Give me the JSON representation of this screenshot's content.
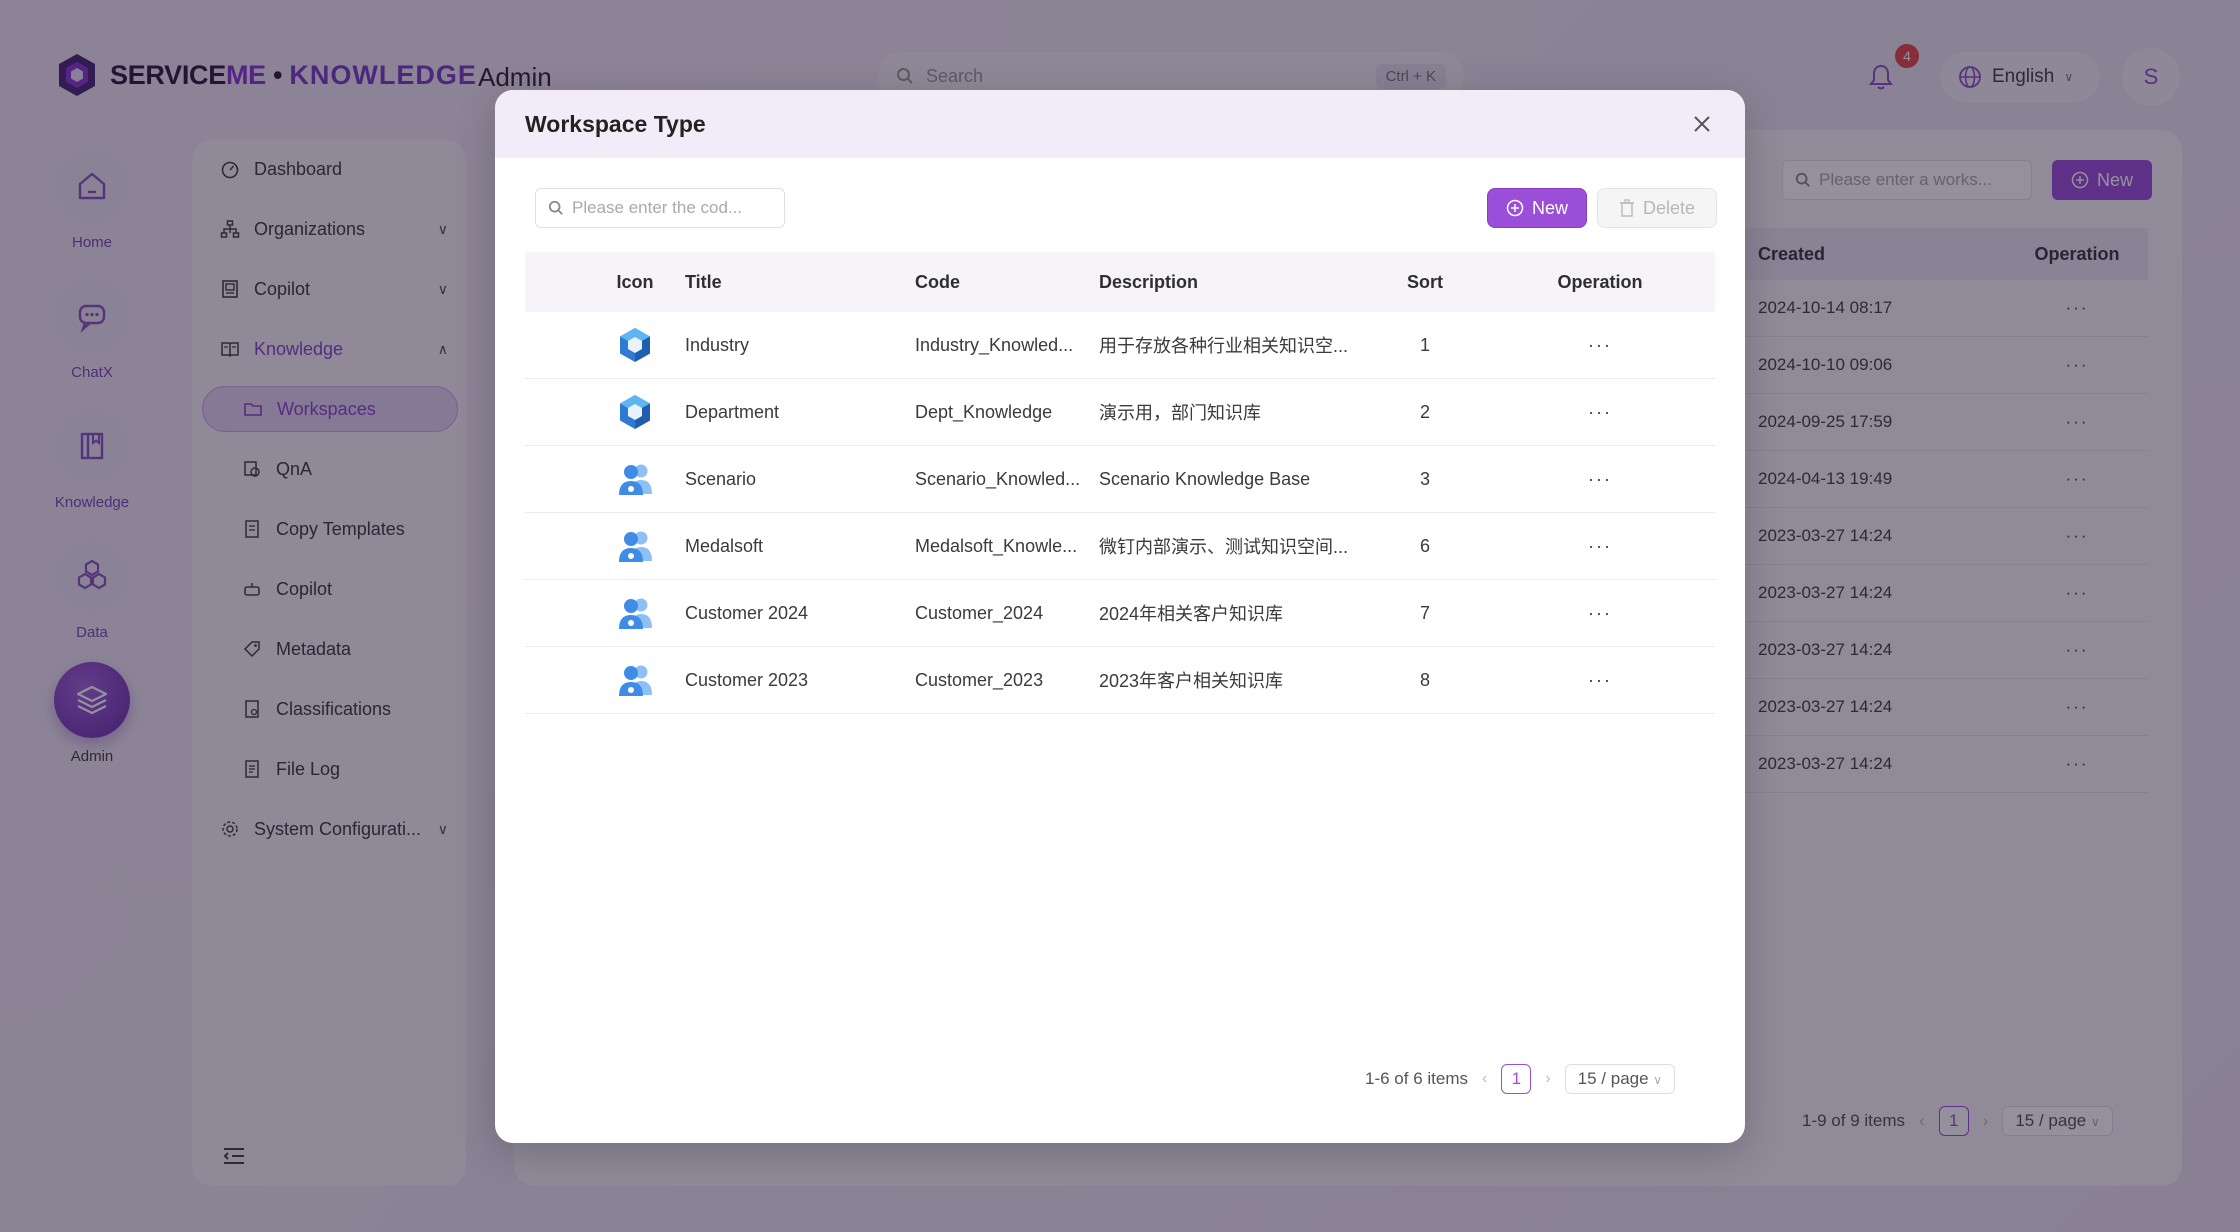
{
  "app": {
    "logo_service": "SERVICE",
    "logo_me": "ME",
    "logo_dot": " • ",
    "logo_knowledge": "KNOWLEDGE",
    "section": "Admin"
  },
  "topbar": {
    "search_placeholder": "Search",
    "search_shortcut": "Ctrl + K",
    "notification_count": "4",
    "language": "English",
    "avatar_initial": "S"
  },
  "rail": [
    {
      "label": "Home",
      "icon": "home-icon"
    },
    {
      "label": "ChatX",
      "icon": "chat-icon"
    },
    {
      "label": "Knowledge",
      "icon": "book-icon"
    },
    {
      "label": "Data",
      "icon": "hexagons-icon"
    },
    {
      "label": "Admin",
      "icon": "layers-icon"
    }
  ],
  "menu": {
    "dashboard": "Dashboard",
    "organizations": "Organizations",
    "copilot": "Copilot",
    "knowledge": "Knowledge",
    "workspaces": "Workspaces",
    "qna": "QnA",
    "copy_templates": "Copy Templates",
    "copilot_sub": "Copilot",
    "metadata": "Metadata",
    "classifications": "Classifications",
    "file_log": "File Log",
    "system_config": "System Configurati..."
  },
  "background": {
    "search_placeholder": "Please enter a works...",
    "new_label": "New",
    "columns": [
      "Created",
      "Operation"
    ],
    "rows": [
      "2024-10-14 08:17",
      "2024-10-10 09:06",
      "2024-09-25 17:59",
      "2024-04-13 19:49",
      "2023-03-27 14:24",
      "2023-03-27 14:24",
      "2023-03-27 14:24",
      "2023-03-27 14:24",
      "2023-03-27 14:24"
    ],
    "op_label": "···",
    "pager_summary": "1-9 of 9 items",
    "pager_page": "1",
    "pager_size": "15 / page"
  },
  "modal": {
    "title": "Workspace Type",
    "search_placeholder": "Please enter the cod...",
    "new_label": "New",
    "delete_label": "Delete",
    "columns": {
      "icon": "Icon",
      "title": "Title",
      "code": "Code",
      "description": "Description",
      "sort": "Sort",
      "operation": "Operation"
    },
    "rows": [
      {
        "icon": "cube-icon",
        "title": "Industry",
        "code": "Industry_Knowled...",
        "description": "用于存放各种行业相关知识空...",
        "sort": "1",
        "op": "···"
      },
      {
        "icon": "cube-icon",
        "title": "Department",
        "code": "Dept_Knowledge",
        "description": "演示用，部门知识库",
        "sort": "2",
        "op": "···"
      },
      {
        "icon": "users-icon",
        "title": "Scenario",
        "code": "Scenario_Knowled...",
        "description": "Scenario Knowledge Base",
        "sort": "3",
        "op": "···"
      },
      {
        "icon": "users-icon",
        "title": "Medalsoft",
        "code": "Medalsoft_Knowle...",
        "description": "微钉内部演示、测试知识空间...",
        "sort": "6",
        "op": "···"
      },
      {
        "icon": "users-icon",
        "title": "Customer 2024",
        "code": "Customer_2024",
        "description": "2024年相关客户知识库",
        "sort": "7",
        "op": "···"
      },
      {
        "icon": "users-icon",
        "title": "Customer 2023",
        "code": "Customer_2023",
        "description": "2023年客户相关知识库",
        "sort": "8",
        "op": "···"
      }
    ],
    "pager_summary": "1-6 of 6 items",
    "pager_page": "1",
    "pager_size": "15 / page"
  },
  "colors": {
    "accent": "#9b4fd9",
    "accent_dark": "#6c2fa9",
    "badge": "#e5484d"
  }
}
